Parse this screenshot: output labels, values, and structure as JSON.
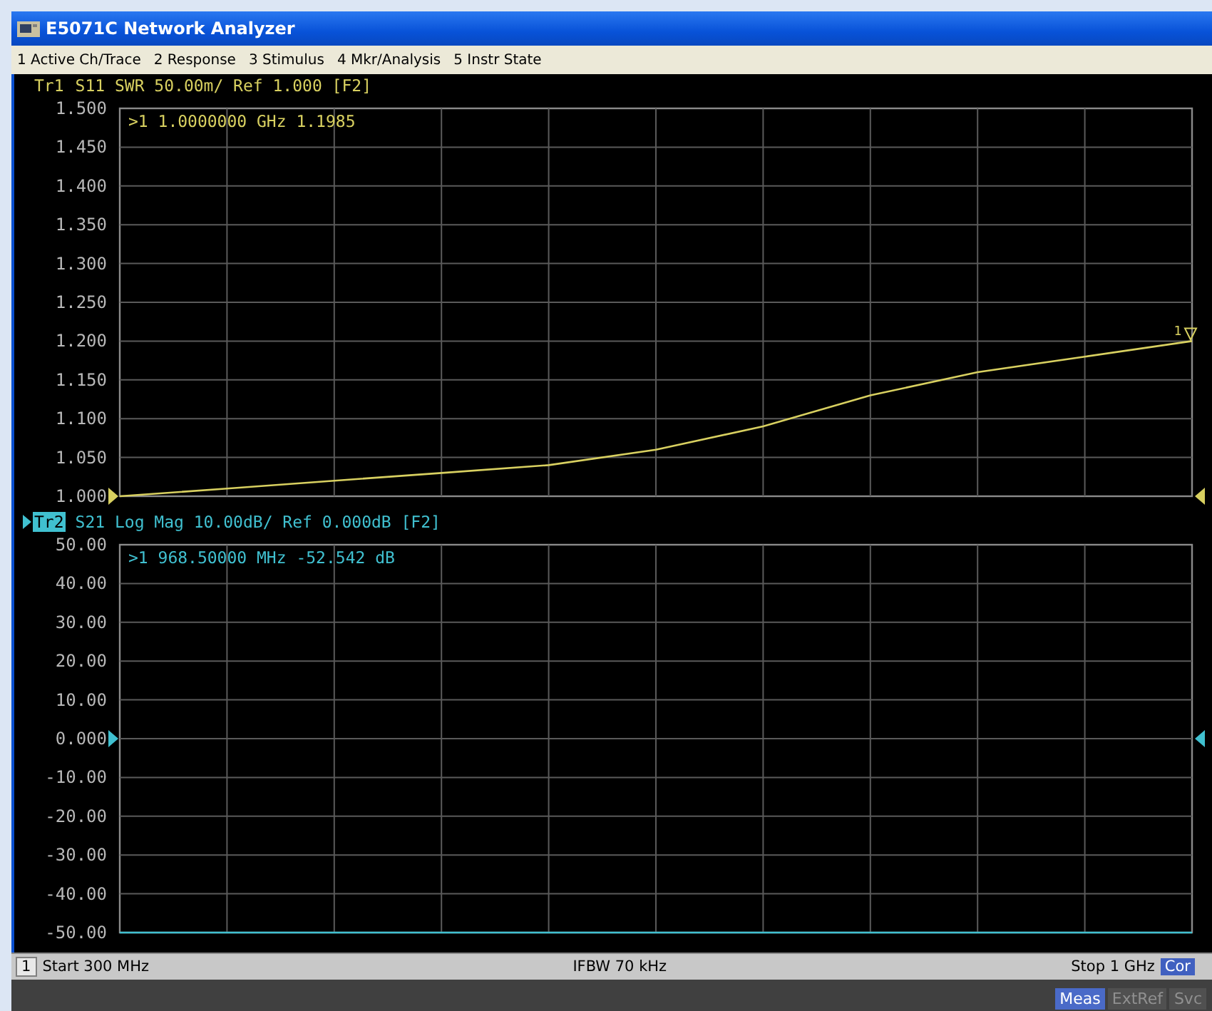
{
  "window": {
    "title": "E5071C Network Analyzer"
  },
  "menu": [
    {
      "label": "1 Active Ch/Trace"
    },
    {
      "label": "2 Response"
    },
    {
      "label": "3 Stimulus"
    },
    {
      "label": "4 Mkr/Analysis"
    },
    {
      "label": "5 Instr State"
    }
  ],
  "traces": [
    {
      "label": "Tr1",
      "selected": false,
      "kind": "bottom",
      "header": "S11 SWR 50.00m/ Ref 1.000 [F2]",
      "marker_readout": ">1  1.0000000 GHz  1.1985",
      "marker_label": "1",
      "chart_data": {
        "type": "line",
        "grid": true,
        "series": [
          {
            "color": "#d8d060",
            "values": [
              1.0,
              1.01,
              1.02,
              1.03,
              1.04,
              1.06,
              1.09,
              1.13,
              1.16,
              1.18,
              1.2
            ]
          }
        ],
        "ylim": [
          1.0,
          1.5
        ],
        "yticks": [
          {
            "value": 1.5,
            "label": "1.500"
          },
          {
            "value": 1.45,
            "label": "1.450"
          },
          {
            "value": 1.4,
            "label": "1.400"
          },
          {
            "value": 1.35,
            "label": "1.350"
          },
          {
            "value": 1.3,
            "label": "1.300"
          },
          {
            "value": 1.25,
            "label": "1.250"
          },
          {
            "value": 1.2,
            "label": "1.200"
          },
          {
            "value": 1.15,
            "label": "1.150"
          },
          {
            "value": 1.1,
            "label": "1.100"
          },
          {
            "value": 1.05,
            "label": "1.050"
          },
          {
            "value": 1.0,
            "label": "1.000"
          }
        ]
      }
    },
    {
      "label": "Tr2",
      "selected": true,
      "kind": "middle",
      "header": "S21 Log Mag 10.00dB/ Ref 0.000dB [F2]",
      "marker_readout": ">1  968.50000 MHz -52.542 dB",
      "chart_data": {
        "type": "line",
        "grid": true,
        "series": [
          {
            "color": "#40c0d0",
            "values": [
              -50,
              -50,
              -50,
              -50,
              -50,
              -50,
              -50,
              -50,
              -50,
              -50,
              -50
            ]
          }
        ],
        "ylim": [
          -50,
          50
        ],
        "yticks": [
          {
            "value": 50,
            "label": "50.00"
          },
          {
            "value": 40,
            "label": "40.00"
          },
          {
            "value": 30,
            "label": "30.00"
          },
          {
            "value": 20,
            "label": "20.00"
          },
          {
            "value": 10,
            "label": "10.00"
          },
          {
            "value": 0,
            "label": "0.000"
          },
          {
            "value": -10,
            "label": "-10.00"
          },
          {
            "value": -20,
            "label": "-20.00"
          },
          {
            "value": -30,
            "label": "-30.00"
          },
          {
            "value": -40,
            "label": "-40.00"
          },
          {
            "value": -50,
            "label": "-50.00"
          }
        ]
      }
    }
  ],
  "status_bar": {
    "channel": "1",
    "start": "Start 300 MHz",
    "ifbw": "IFBW 70 kHz",
    "stop": "Stop 1 GHz",
    "correction": "Cor"
  },
  "bottom_bar": [
    {
      "label": "Meas",
      "selected": true
    },
    {
      "label": "ExtRef",
      "selected": false
    },
    {
      "label": "Svc",
      "selected": false
    }
  ]
}
